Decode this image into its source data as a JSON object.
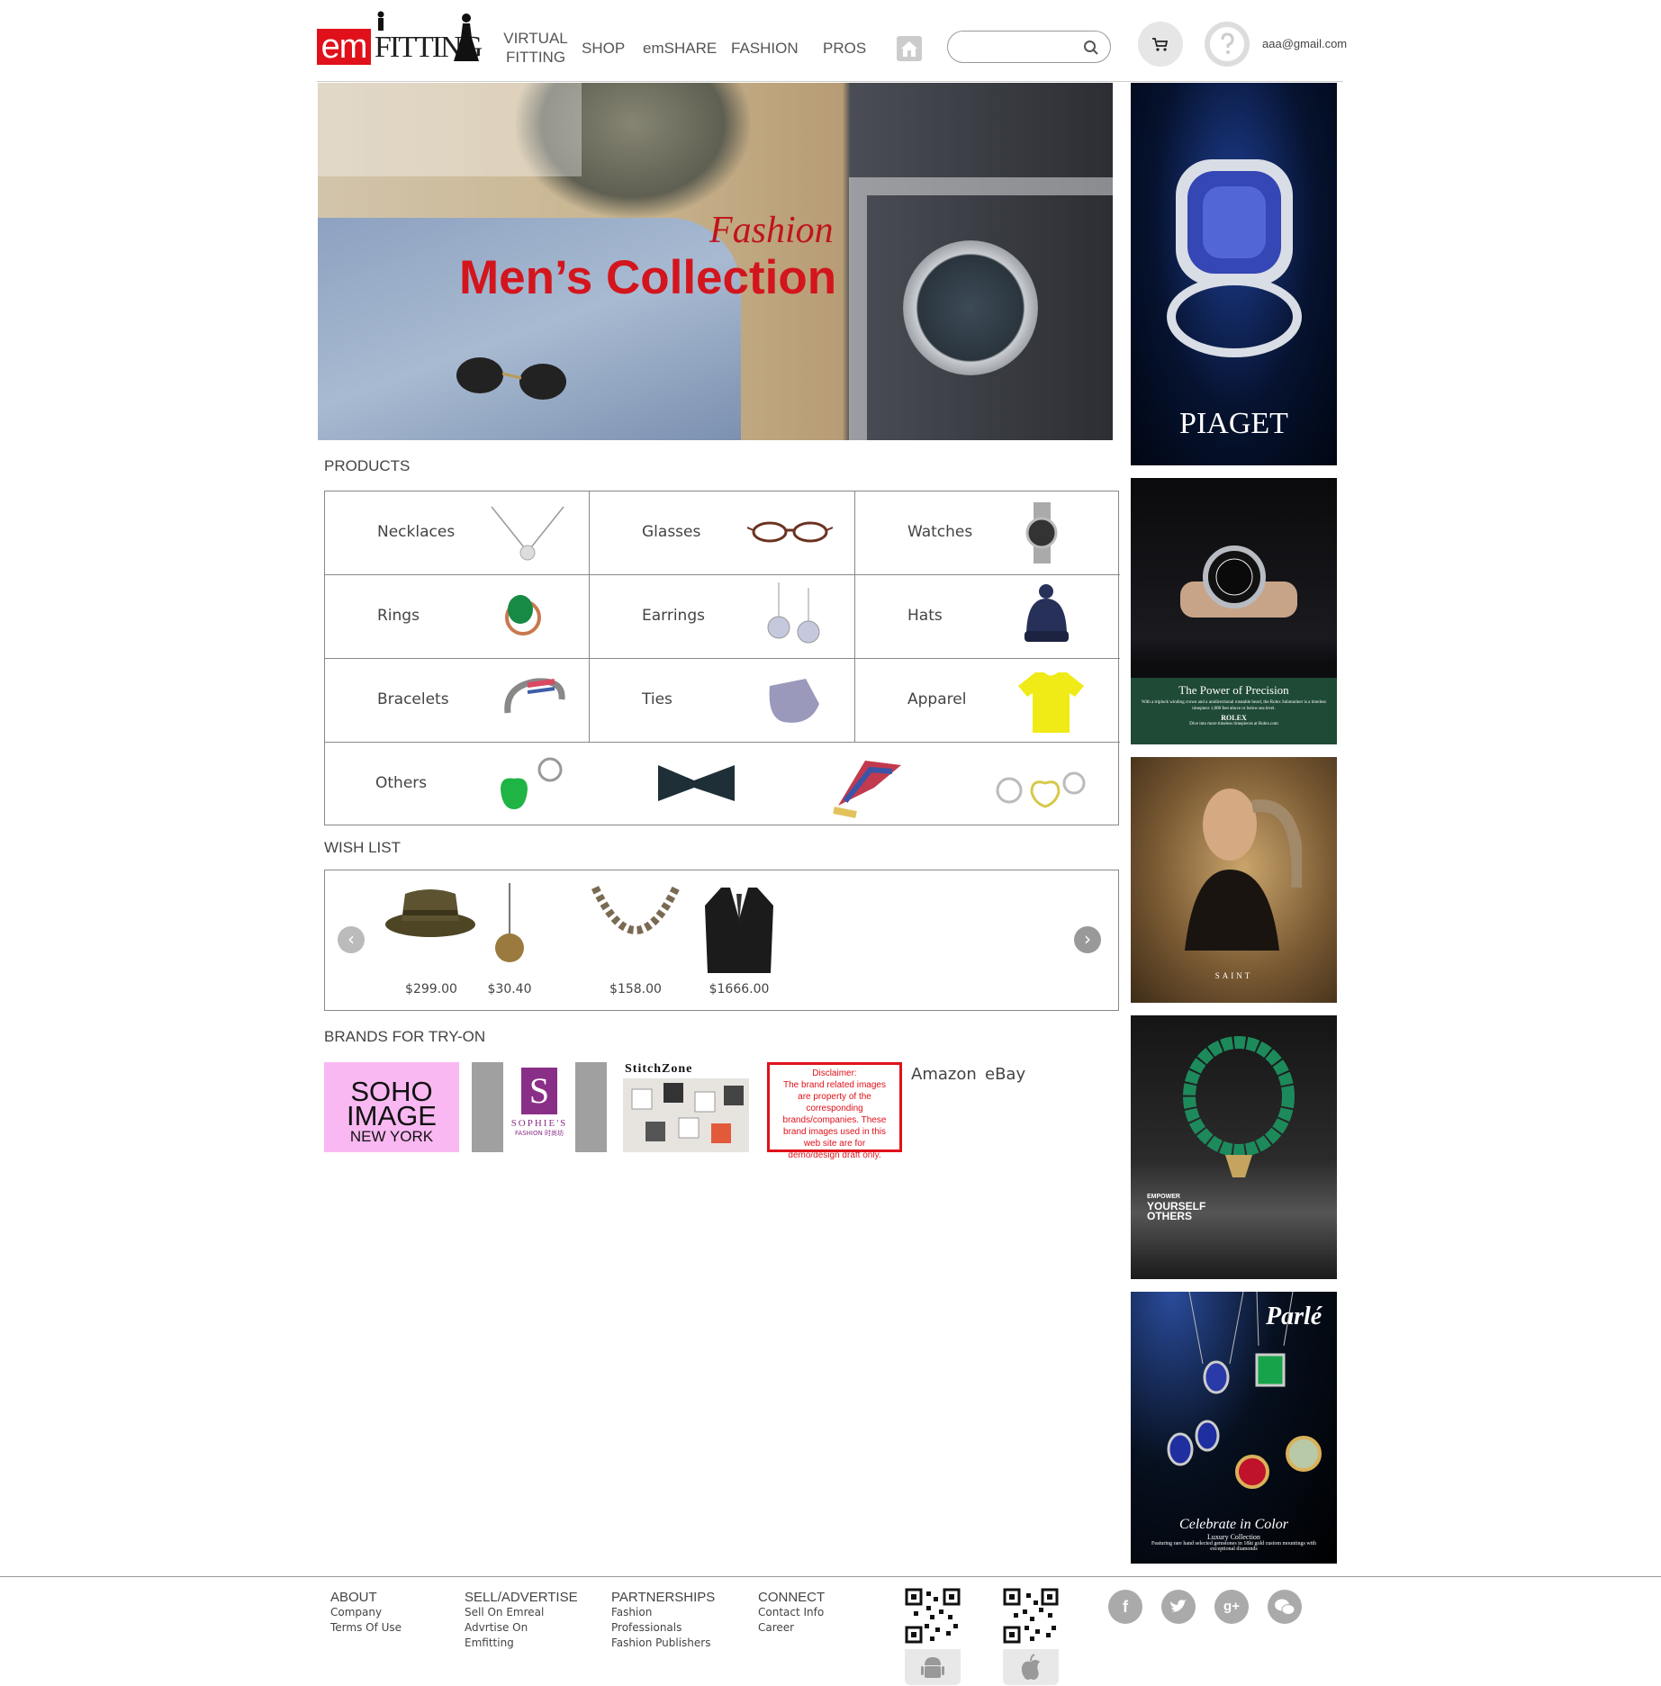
{
  "header": {
    "logo_em": "em",
    "logo_fitting": "FITTING",
    "nav": [
      {
        "line1": "VIRTUAL",
        "line2": "FITTING"
      },
      {
        "line1": "SHOP"
      },
      {
        "line1": "emSHARE"
      },
      {
        "line1": "FASHION"
      },
      {
        "line1": "PROS"
      }
    ],
    "search_value": "",
    "user_email": "aaa@gmail.com"
  },
  "hero": {
    "subtitle": "Fashion",
    "title": "Men’s Collection"
  },
  "products": {
    "title": "PRODUCTS",
    "items": [
      "Necklaces",
      "Glasses",
      "Watches",
      "Rings",
      "Earrings",
      "Hats",
      "Bracelets",
      "Ties",
      "Apparel",
      "Others"
    ]
  },
  "wishlist": {
    "title": "WISH LIST",
    "prices": [
      "$299.00",
      "$30.40",
      "$158.00",
      "$1666.00"
    ]
  },
  "brands": {
    "title": "BRANDS FOR TRY-ON",
    "soho_line1": "SOHO",
    "soho_line2": "IMAGE",
    "soho_line3": "NEW YORK",
    "sophies": "SOPHIE'S",
    "sophies_sub": "FASHION 时尚坊",
    "stitchzone": "StitchZone",
    "disclaimer_title": "Disclaimer:",
    "disclaimer_body": "The brand related images are property of the corresponding brands/companies. These brand images used in this web site are for demo/design draft only.",
    "amazon": "Amazon",
    "ebay": "eBay"
  },
  "ads": {
    "piaget": "PIAGET",
    "rolex_headline": "The Power of Precision",
    "rolex_body": "With a triplock winding crown and a unidirectional rotatable bezel, the Rolex Submariner is a timeless timepiece 1,000 feet above or below sea level.",
    "rolex_brand": "ROLEX",
    "rolex_footer": "Dive into more timeless timepieces at Rolex.com",
    "saint": "SAINT",
    "empower_line1": "EMPOWER",
    "empower_line2": "YOURSELF",
    "empower_line3": "OTHERS",
    "parle": "Parlé",
    "parle_title": "Celebrate in Color",
    "parle_sub": "Luxury Collection",
    "parle_body": "Featuring rare hand selected gemstones in 18kt gold custom mountings with exceptional diamonds"
  },
  "footer": {
    "about": {
      "head": "ABOUT",
      "links": [
        "Company",
        "Terms Of Use"
      ]
    },
    "sell": {
      "head": "SELL/ADVERTISE",
      "links": [
        "Sell On Emreal",
        "Advrtise On",
        "Emfitting"
      ]
    },
    "partnerships": {
      "head": "PARTNERSHIPS",
      "links": [
        "Fashion",
        "Professionals",
        "Fashion Publishers"
      ]
    },
    "connect": {
      "head": "CONNECT",
      "links": [
        "Contact Info",
        "Career"
      ]
    },
    "social": [
      "facebook-icon",
      "twitter-icon",
      "google-plus-icon",
      "wechat-icon"
    ]
  },
  "colors": {
    "brand_red": "#e0111a",
    "soho_pink": "#f9b8f2",
    "sophies_purple": "#8a2f88",
    "rolex_green": "#1f4a36"
  }
}
